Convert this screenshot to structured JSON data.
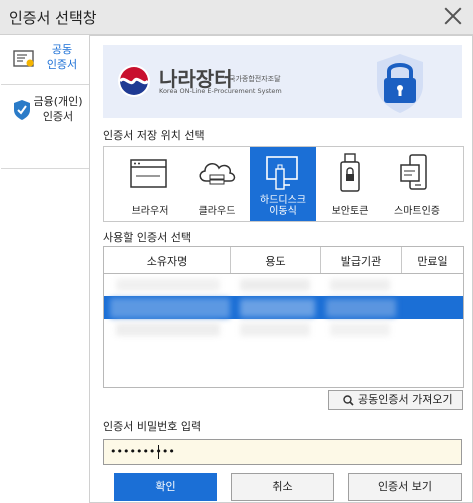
{
  "window": {
    "title": "인증서 선택창"
  },
  "sidebar": {
    "items": [
      {
        "label_line1": "공동",
        "label_line2": "인증서",
        "active": true
      },
      {
        "label_line1": "금융(개인)",
        "label_line2": "인증서",
        "active": false
      }
    ]
  },
  "banner": {
    "brand_main": "나라장터",
    "brand_small": "국가종합전자조달",
    "brand_eng": "Korea ON-Line E-Procurement System"
  },
  "storage_section": {
    "label": "인증서 저장 위치 선택",
    "items": [
      {
        "label": "브라우저",
        "icon": "browser-window-icon"
      },
      {
        "label": "클라우드",
        "icon": "cloud-icon"
      },
      {
        "label_line1": "하드디스크",
        "label_line2": "이동식",
        "icon": "usb-monitor-icon",
        "selected": true
      },
      {
        "label": "보안토큰",
        "icon": "security-token-icon"
      },
      {
        "label": "스마트인증",
        "icon": "smart-auth-icon"
      }
    ]
  },
  "cert_section": {
    "label": "사용할 인증서 선택",
    "columns": [
      "소유자명",
      "용도",
      "발급기관",
      "만료일"
    ],
    "rows_obscured": true,
    "selected_row": 2
  },
  "actions": {
    "import_button": "공동인증서 가져오기"
  },
  "password": {
    "label": "인증서 비밀번호 입력",
    "value": "••••••••••"
  },
  "footer": {
    "confirm": "확인",
    "cancel": "취소",
    "view": "인증서 보기"
  },
  "colors": {
    "accent": "#1b6fd6",
    "banner_bg": "#e9eef9",
    "password_bg": "#fdf9e7"
  }
}
